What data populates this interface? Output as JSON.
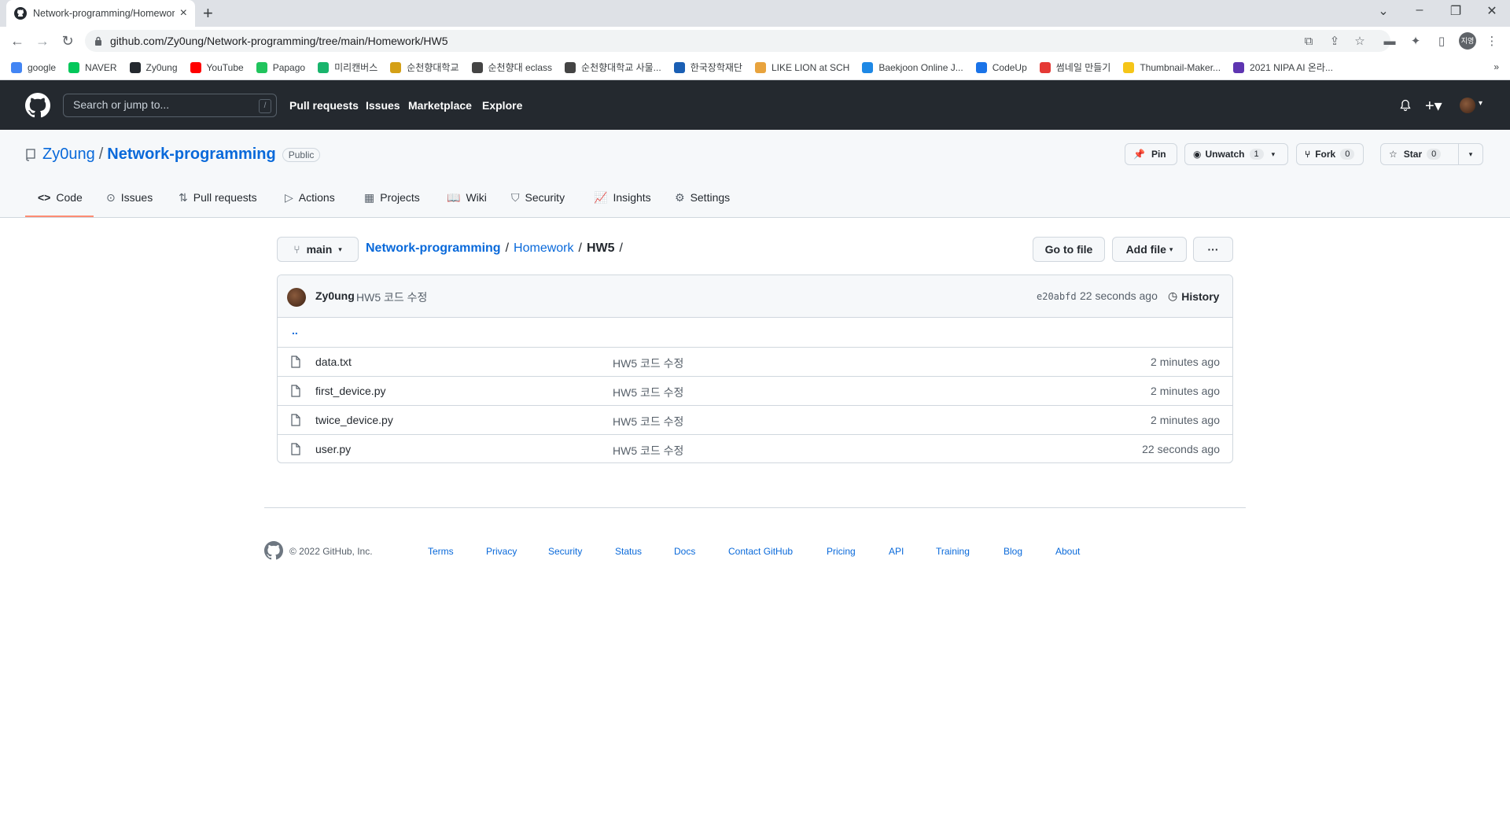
{
  "browser": {
    "tab_title": "Network-programming/Homework/HW5",
    "url": "github.com/Zy0ung/Network-programming/tree/main/Homework/HW5",
    "profile_initials": "지영",
    "bookmarks": [
      {
        "label": "google",
        "color": "#4285f4"
      },
      {
        "label": "NAVER",
        "color": "#03c75a"
      },
      {
        "label": "Zy0ung",
        "color": "#24292f"
      },
      {
        "label": "YouTube",
        "color": "#ff0000"
      },
      {
        "label": "Papago",
        "color": "#21c45d"
      },
      {
        "label": "미리캔버스",
        "color": "#19b46c"
      },
      {
        "label": "순천향대학교",
        "color": "#d4a017"
      },
      {
        "label": "순천향대 eclass",
        "color": "#444444"
      },
      {
        "label": "순천향대학교 사물...",
        "color": "#444444"
      },
      {
        "label": "한국장학재단",
        "color": "#1a5fb4"
      },
      {
        "label": "LIKE LION at SCH",
        "color": "#e8a33d"
      },
      {
        "label": "Baekjoon Online J...",
        "color": "#1e88e5"
      },
      {
        "label": "CodeUp",
        "color": "#1a73e8"
      },
      {
        "label": "썸네일 만들기",
        "color": "#e53935"
      },
      {
        "label": "Thumbnail-Maker...",
        "color": "#f5c518"
      },
      {
        "label": "2021 NIPA AI 온라...",
        "color": "#5e35b1"
      }
    ]
  },
  "gh_header": {
    "search_placeholder": "Search or jump to...",
    "search_key": "/",
    "nav": [
      "Pull requests",
      "Issues",
      "Marketplace",
      "Explore"
    ]
  },
  "repo": {
    "owner": "Zy0ung",
    "name": "Network-programming",
    "visibility": "Public",
    "pin_label": "Pin",
    "unwatch_label": "Unwatch",
    "unwatch_count": "1",
    "fork_label": "Fork",
    "fork_count": "0",
    "star_label": "Star",
    "star_count": "0",
    "tabs": [
      "Code",
      "Issues",
      "Pull requests",
      "Actions",
      "Projects",
      "Wiki",
      "Security",
      "Insights",
      "Settings"
    ]
  },
  "browser_bar": {
    "branch": "main",
    "crumbs": [
      "Network-programming",
      "Homework",
      "HW5"
    ],
    "go_to_file": "Go to file",
    "add_file": "Add file",
    "more": "···"
  },
  "commit": {
    "author": "Zy0ung",
    "message": "HW5 코드 수정",
    "sha": "e20abfd",
    "time": "22 seconds ago",
    "history_label": "History"
  },
  "files": {
    "parent": "..",
    "rows": [
      {
        "name": "data.txt",
        "message": "HW5 코드 수정",
        "age": "2 minutes ago"
      },
      {
        "name": "first_device.py",
        "message": "HW5 코드 수정",
        "age": "2 minutes ago"
      },
      {
        "name": "twice_device.py",
        "message": "HW5 코드 수정",
        "age": "2 minutes ago"
      },
      {
        "name": "user.py",
        "message": "HW5 코드 수정",
        "age": "22 seconds ago"
      }
    ]
  },
  "footer": {
    "copyright": "© 2022 GitHub, Inc.",
    "links": [
      "Terms",
      "Privacy",
      "Security",
      "Status",
      "Docs",
      "Contact GitHub",
      "Pricing",
      "API",
      "Training",
      "Blog",
      "About"
    ]
  }
}
